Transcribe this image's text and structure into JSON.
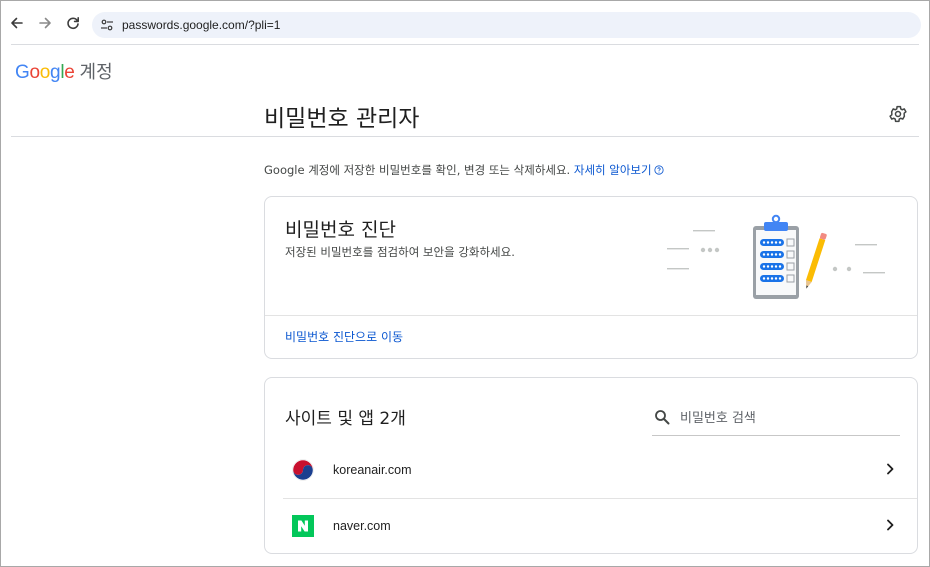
{
  "browser": {
    "url": "passwords.google.com/?pli=1",
    "icons": {
      "back": "arrow-left-icon",
      "forward": "arrow-right-icon",
      "reload": "reload-icon",
      "site_info": "tune-icon"
    }
  },
  "header": {
    "logo_letters": [
      "G",
      "o",
      "o",
      "g",
      "l",
      "e"
    ],
    "account_word": "계정",
    "title": "비밀번호 관리자",
    "settings_icon": "gear-icon"
  },
  "intro": {
    "text": "Google 계정에 저장한 비밀번호를 확인, 변경 또는 삭제하세요. ",
    "link": "자세히 알아보기",
    "help_icon": "help-circle-icon"
  },
  "checkup": {
    "title": "비밀번호 진단",
    "description": "저장된 비밀번호를 점검하여 보안을 강화하세요.",
    "link": "비밀번호 진단으로 이동",
    "illustration": "clipboard-checklist-illustration"
  },
  "sites": {
    "title": "사이트 및 앱 2개",
    "search_placeholder": "비밀번호 검색",
    "search_value": "",
    "items": [
      {
        "name": "koreanair.com",
        "logo": "koreanair-logo-icon"
      },
      {
        "name": "naver.com",
        "logo": "naver-logo-icon"
      }
    ]
  },
  "colors": {
    "accent_blue": "#0b57d0",
    "naver_green": "#03c75a",
    "koreanair_red": "#c8102e",
    "koreanair_blue": "#1b3f8f"
  }
}
